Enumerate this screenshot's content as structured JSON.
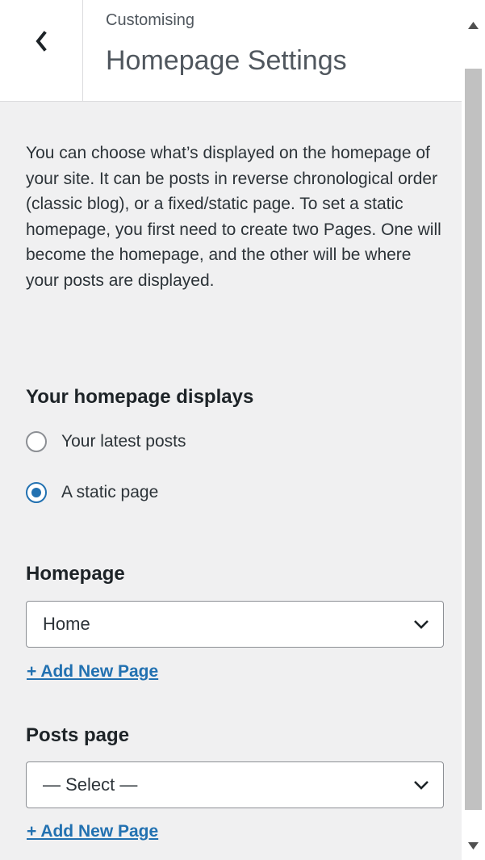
{
  "header": {
    "subtitle": "Customising",
    "title": "Homepage Settings"
  },
  "description": "You can choose what’s displayed on the homepage of your site. It can be posts in reverse chronological order (classic blog), or a fixed/static page. To set a static homepage, you first need to create two Pages. One will become the homepage, and the other will be where your posts are displayed.",
  "homepage_displays": {
    "title": "Your homepage displays",
    "options": [
      {
        "label": "Your latest posts",
        "checked": false
      },
      {
        "label": "A static page",
        "checked": true
      }
    ]
  },
  "homepage": {
    "label": "Homepage",
    "selected": "Home",
    "add_link": "+ Add New Page"
  },
  "posts_page": {
    "label": "Posts page",
    "selected": "— Select —",
    "add_link": "+ Add New Page"
  },
  "colors": {
    "accent": "#2271b1",
    "background": "#f0f0f1",
    "text": "#1d2327"
  },
  "icons": {
    "back": "chevron-left-icon",
    "dropdown": "chevron-down-icon",
    "scroll_up": "triangle-up-icon",
    "scroll_down": "triangle-down-icon"
  }
}
